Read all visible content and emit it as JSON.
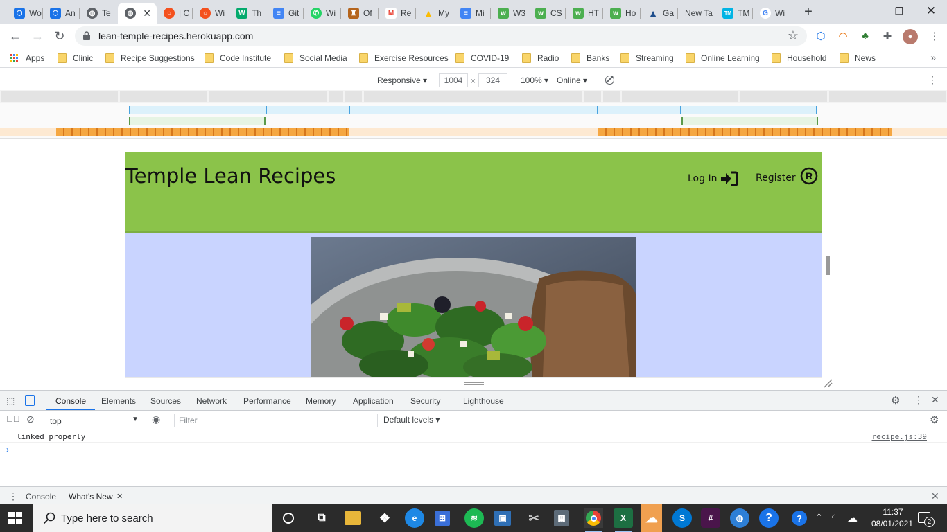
{
  "tabs": [
    {
      "title": "Wo",
      "icon": "hex-icon",
      "color": "#1a73e8"
    },
    {
      "title": "An",
      "icon": "hex-icon",
      "color": "#1a73e8"
    },
    {
      "title": "Te",
      "icon": "globe-icon",
      "color": "#5f6368"
    },
    {
      "title": "",
      "icon": "globe-icon",
      "color": "#5f6368",
      "active": true
    },
    {
      "title": "| C",
      "icon": "ring-icon",
      "color": "#f4511e"
    },
    {
      "title": "Wi",
      "icon": "ring-icon",
      "color": "#f4511e"
    },
    {
      "title": "Th",
      "icon": "w3-icon",
      "color": "#04aa6d"
    },
    {
      "title": "Git",
      "icon": "docs-icon",
      "color": "#4285f4"
    },
    {
      "title": "Wi",
      "icon": "whatsapp-icon",
      "color": "#25d366"
    },
    {
      "title": "Of",
      "icon": "crest-icon",
      "color": "#b5651d"
    },
    {
      "title": "Re",
      "icon": "gmail-icon",
      "color": "#ea4335"
    },
    {
      "title": "My",
      "icon": "drive-icon",
      "color": "#fbbc04"
    },
    {
      "title": "Mi",
      "icon": "docs-icon",
      "color": "#4285f4"
    },
    {
      "title": "W3",
      "icon": "w3-icon",
      "color": "#4caf50"
    },
    {
      "title": "CS",
      "icon": "w3-icon",
      "color": "#4caf50"
    },
    {
      "title": "HT",
      "icon": "w3-icon",
      "color": "#4caf50"
    },
    {
      "title": "Ho",
      "icon": "w3-icon",
      "color": "#4caf50"
    },
    {
      "title": "Ga",
      "icon": "triangle-icon",
      "color": "#1e4e8c"
    },
    {
      "title": "New Ta",
      "icon": "",
      "color": ""
    },
    {
      "title": "TM",
      "icon": "tmdb-icon",
      "color": "#01b4e4"
    },
    {
      "title": "Wi",
      "icon": "google-icon",
      "color": "#4285f4"
    }
  ],
  "window": {
    "minimize": "—",
    "maximize": "❐",
    "close": "✕",
    "new_tab": "+"
  },
  "address": {
    "url": "lean-temple-recipes.herokuapp.com"
  },
  "bookmarks": [
    "Apps",
    "Clinic",
    "Recipe Suggestions",
    "Code Institute",
    "Social Media",
    "Exercise Resources",
    "COVID-19",
    "Radio",
    "Banks",
    "Streaming",
    "Online Learning",
    "Household",
    "News"
  ],
  "device_toolbar": {
    "mode": "Responsive",
    "width": "1004",
    "height": "324",
    "zoom": "100%",
    "network": "Online"
  },
  "site": {
    "brand": "Temple Lean Recipes",
    "login": "Log In",
    "register": "Register"
  },
  "devtools": {
    "tabs": [
      "Console",
      "Elements",
      "Sources",
      "Network",
      "Performance",
      "Memory",
      "Application",
      "Security",
      "Lighthouse"
    ],
    "active_tab": "Console",
    "context": "top",
    "filter_placeholder": "Filter",
    "levels": "Default levels",
    "messages": [
      {
        "text": "linked properly",
        "source": "recipe.js:39"
      }
    ],
    "drawer_tabs": [
      "Console",
      "What's New"
    ]
  },
  "taskbar": {
    "search_placeholder": "Type here to search",
    "time": "11:37",
    "date": "08/01/2021",
    "notifications": "2"
  },
  "colors": {
    "site_header": "#8bc34a",
    "site_body": "#c9d4ff",
    "devtools_accent": "#1a73e8"
  }
}
